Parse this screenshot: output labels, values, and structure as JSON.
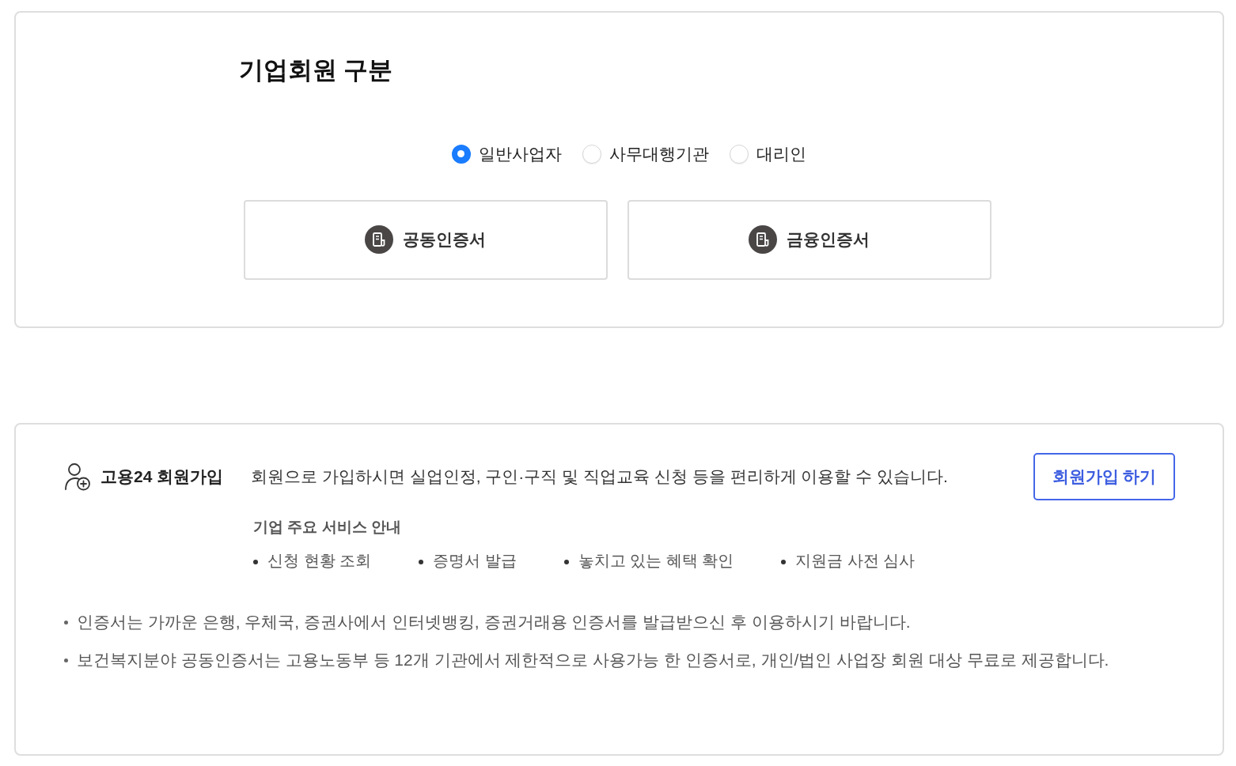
{
  "section_title": "기업회원 구분",
  "member_types": [
    {
      "label": "일반사업자",
      "selected": true
    },
    {
      "label": "사무대행기관",
      "selected": false
    },
    {
      "label": "대리인",
      "selected": false
    }
  ],
  "certificate_buttons": [
    {
      "label": "공동인증서"
    },
    {
      "label": "금융인증서"
    }
  ],
  "signup": {
    "title": "고용24 회원가입",
    "description": "회원으로 가입하시면 실업인정, 구인·구직 및 직업교육 신청 등을 편리하게 이용할 수 있습니다.",
    "button": "회원가입 하기",
    "services_title": "기업 주요 서비스 안내",
    "services": [
      "신청 현황 조회",
      "증명서 발급",
      "놓치고 있는 혜택 확인",
      "지원금 사전 심사"
    ]
  },
  "notes": [
    "인증서는 가까운 은행, 우체국, 증권사에서 인터넷뱅킹, 증권거래용 인증서를 발급받으신 후 이용하시기 바랍니다.",
    "보건복지분야 공동인증서는 고용노동부 등 12개 기관에서 제한적으로 사용가능 한 인증서로, 개인/법인 사업장 회원 대상 무료로 제공합니다."
  ]
}
